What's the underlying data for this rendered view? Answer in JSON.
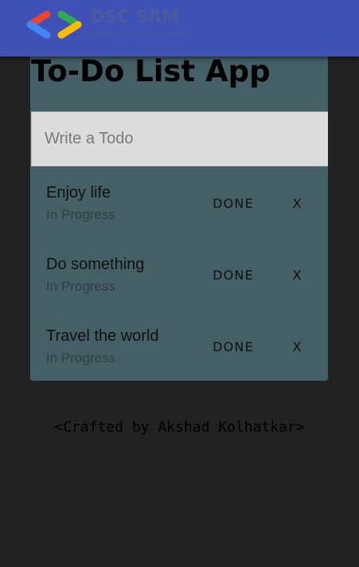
{
  "header": {
    "brand_name": "DSC SRM",
    "brand_sub": "powered by Google Developers",
    "logo_icon": "google-developers-logo-icon"
  },
  "app": {
    "title": "To-Do List App",
    "input_placeholder": "Write a Todo",
    "input_value": ""
  },
  "todos": [
    {
      "text": "Enjoy life",
      "status": "In Progress",
      "done_label": "DONE",
      "delete_label": "X"
    },
    {
      "text": "Do something",
      "status": "In Progress",
      "done_label": "DONE",
      "delete_label": "X"
    },
    {
      "text": "Travel the world",
      "status": "In Progress",
      "done_label": "DONE",
      "delete_label": "X"
    }
  ],
  "footer": {
    "credit": "<Crafted by Akshad Kolhatkar>"
  },
  "colors": {
    "appbar": "#3f51b5",
    "background": "#222222",
    "card": "#455f66",
    "input": "#dcdcdc",
    "logo_red": "#ea4335",
    "logo_blue": "#4285f4",
    "logo_green": "#34a853",
    "logo_yellow": "#fbbc04"
  }
}
